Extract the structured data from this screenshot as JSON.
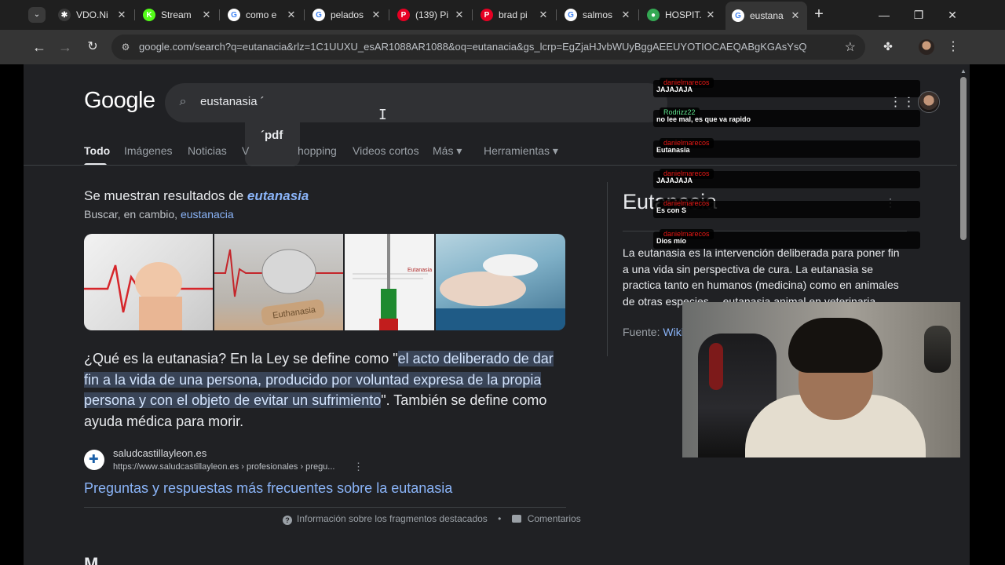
{
  "browser": {
    "tabs": [
      {
        "title": "VDO.Ni",
        "favicon_color": "#3a3a3a",
        "glyph": "✱"
      },
      {
        "title": "Stream",
        "favicon_color": "#53fc18",
        "glyph": "K"
      },
      {
        "title": "como e",
        "favicon_color": "#ffffff",
        "glyph": "G"
      },
      {
        "title": "pelados",
        "favicon_color": "#ffffff",
        "glyph": "G"
      },
      {
        "title": "(139) Pi",
        "favicon_color": "#e60023",
        "glyph": "P"
      },
      {
        "title": "brad pi",
        "favicon_color": "#e60023",
        "glyph": "P"
      },
      {
        "title": "salmos",
        "favicon_color": "#ffffff",
        "glyph": "G"
      },
      {
        "title": "HOSPIT.",
        "favicon_color": "#34a853",
        "glyph": "●"
      },
      {
        "title": "eustana",
        "favicon_color": "#ffffff",
        "glyph": "G",
        "active": true
      }
    ],
    "address": "google.com/search?q=eutanacia&rlz=1C1UUXU_esAR1088AR1088&oq=eutanacia&gs_lcrp=EgZjaHJvbWUyBggAEEUYOTIOCAEQABgKGAsYsQMYgA..."
  },
  "google": {
    "logo": "Google",
    "query": "eustanasia ´",
    "suggestion": "´pdf",
    "tabs": [
      "Todo",
      "Imágenes",
      "Noticias",
      "V",
      "hopping",
      "Videos cortos",
      "Más",
      "Herramientas"
    ],
    "showing_prefix": "Se muestran resultados de ",
    "showing_term": "eutanasia",
    "instead_prefix": "Buscar, en cambio, ",
    "instead_term": "eustanacia",
    "image_labels": [
      "Euthanasia",
      "Eutanasia"
    ],
    "snippet": {
      "before": "¿Qué es la eutanasia? En la Ley se define como \"",
      "highlight": "el acto deliberado de dar fin a la vida de una persona, producido por voluntad expresa de la propia persona y con el objeto de evitar un sufrimiento",
      "after": "\". También se define como ayuda médica para morir."
    },
    "source": {
      "name": "saludcastillayleon.es",
      "url": "https://www.saludcastillayleon.es › profesionales › pregu..."
    },
    "result_title": "Preguntas y respuestas más frecuentes sobre la eutanasia",
    "footer": {
      "info": "Información sobre los fragmentos destacados",
      "feedback": "Comentarios"
    },
    "peek": "M"
  },
  "knowledge_panel": {
    "title": "Eutanasia",
    "text": "La eutanasia es la intervención deliberada para poner fin a una vida sin perspectiva de cura. La eutanasia se practica tanto en humanos (medicina) como en animales de otras especies —eutanasia animal en veterinaria—.",
    "source_label": "Fuente: ",
    "source_link": "Wiki"
  },
  "chat": [
    {
      "user": "danielmarecos",
      "user_color": "#e91916",
      "text": "JAJAJAJA"
    },
    {
      "user": "Rodrizz22",
      "user_color": "#5fe38c",
      "text": "no lee mal, es que va rapido"
    },
    {
      "user": "danielmarecos",
      "user_color": "#e91916",
      "text": "Eutanasia"
    },
    {
      "user": "danielmarecos",
      "user_color": "#e91916",
      "text": "JAJAJAJA"
    },
    {
      "user": "danielmarecos",
      "user_color": "#e91916",
      "text": "Es con S"
    },
    {
      "user": "danielmarecos",
      "user_color": "#e91916",
      "text": "Dios mío"
    }
  ]
}
